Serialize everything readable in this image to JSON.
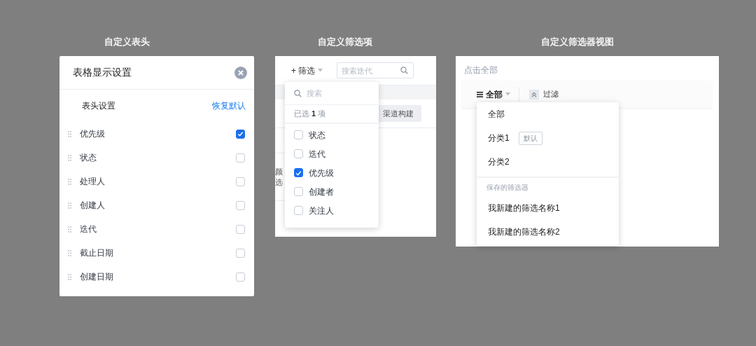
{
  "column_settings": {
    "caption": "自定义表头",
    "dialog_title": "表格显示设置",
    "section_label": "表头设置",
    "reset_link": "恢复默认",
    "columns": [
      {
        "label": "优先级",
        "checked": true
      },
      {
        "label": "状态",
        "checked": false
      },
      {
        "label": "处理人",
        "checked": false
      },
      {
        "label": "创建人",
        "checked": false
      },
      {
        "label": "迭代",
        "checked": false
      },
      {
        "label": "截止日期",
        "checked": false
      },
      {
        "label": "创建日期",
        "checked": false
      }
    ]
  },
  "filter_options": {
    "caption": "自定义筛选项",
    "filter_button": "+ 筛选",
    "search": {
      "placeholder": "搜索迭代"
    },
    "chip": "渠道构建",
    "fragments": [
      "颜",
      "选"
    ],
    "dropdown": {
      "search_placeholder": "搜索",
      "summary": "已选 **1** 项",
      "options": [
        {
          "label": "状态",
          "checked": false
        },
        {
          "label": "迭代",
          "checked": false
        },
        {
          "label": "优先级",
          "checked": true
        },
        {
          "label": "创建者",
          "checked": false
        },
        {
          "label": "关注人",
          "checked": false
        }
      ]
    }
  },
  "filter_views": {
    "caption": "自定义筛选器视图",
    "hint": "点击全部",
    "view_button": "全部",
    "filter_label": "过滤",
    "menu": {
      "items": [
        {
          "label": "全部"
        },
        {
          "label": "分类1",
          "badge": "默认"
        },
        {
          "label": "分类2"
        }
      ],
      "section_label": "保存的筛选器",
      "saved": [
        {
          "label": "我新建的筛选名称1"
        },
        {
          "label": "我新建的筛选名称2"
        }
      ]
    }
  }
}
